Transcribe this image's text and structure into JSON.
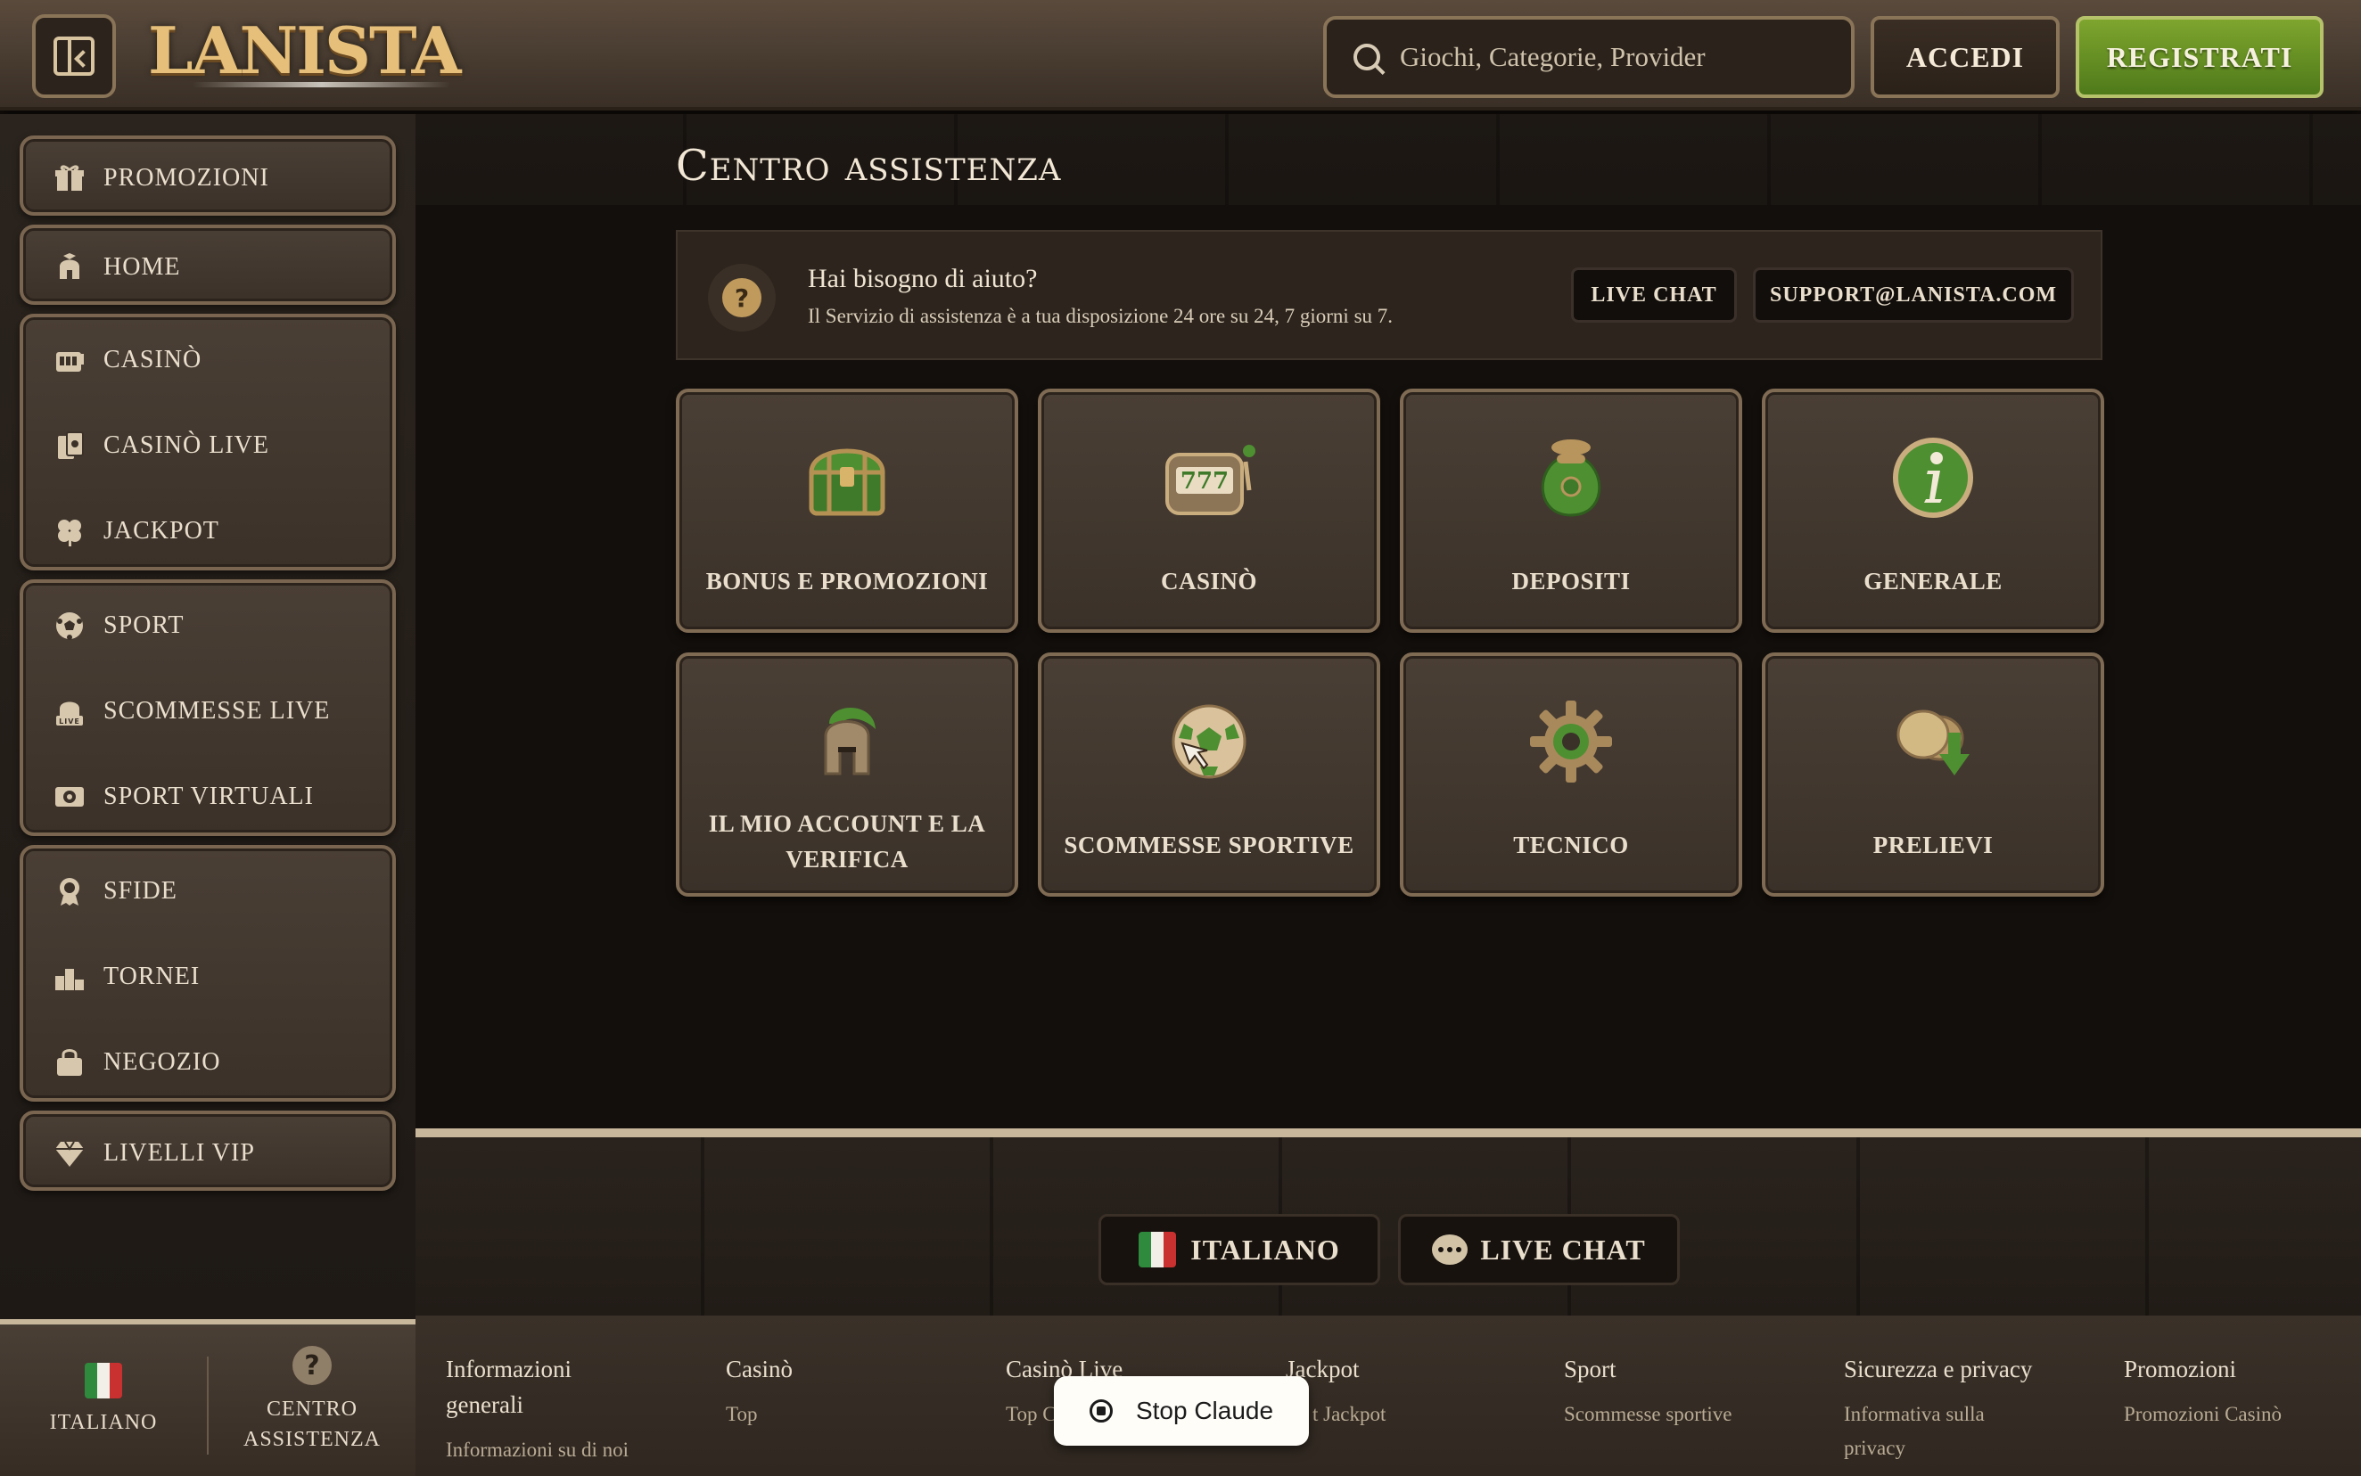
{
  "header": {
    "logo": "LANISTA",
    "search_placeholder": "Giochi, Categorie, Provider",
    "login_label": "ACCEDI",
    "register_label": "REGISTRATI"
  },
  "sidebar": {
    "items": [
      {
        "label": "PROMOZIONI",
        "icon": "gift-icon"
      },
      {
        "label": "HOME",
        "icon": "helmet-icon"
      },
      {
        "label": "CASINÒ",
        "icon": "slot-icon"
      },
      {
        "label": "CASINÒ LIVE",
        "icon": "cards-icon"
      },
      {
        "label": "JACKPOT",
        "icon": "clover-icon"
      },
      {
        "label": "SPORT",
        "icon": "soccer-ball-icon"
      },
      {
        "label": "SCOMMESSE LIVE",
        "icon": "live-helmet-icon"
      },
      {
        "label": "SPORT VIRTUALI",
        "icon": "virtual-sport-icon"
      },
      {
        "label": "SFIDE",
        "icon": "medal-icon"
      },
      {
        "label": "TORNEI",
        "icon": "podium-icon"
      },
      {
        "label": "NEGOZIO",
        "icon": "bag-icon"
      },
      {
        "label": "LIVELLI VIP",
        "icon": "diamond-icon"
      }
    ],
    "bottom": {
      "language_label": "ITALIANO",
      "help_label": "CENTRO ASSISTENZA"
    }
  },
  "main": {
    "title": "Centro assistenza",
    "banner": {
      "heading": "Hai bisogno di aiuto?",
      "subtext": "Il Servizio di assistenza è a tua disposizione 24 ore su 24, 7 giorni su 7.",
      "live_chat_label": "LIVE CHAT",
      "email_label": "SUPPORT@LANISTA.COM"
    },
    "categories": [
      {
        "label": "BONUS E PROMOZIONI",
        "icon": "treasure-chest-icon"
      },
      {
        "label": "CASINÒ",
        "icon": "slot-machine-icon"
      },
      {
        "label": "DEPOSITI",
        "icon": "money-bag-icon"
      },
      {
        "label": "GENERALE",
        "icon": "info-icon"
      },
      {
        "label": "IL MIO ACCOUNT E LA VERIFICA",
        "icon": "gladiator-helmet-icon"
      },
      {
        "label": "SCOMMESSE SPORTIVE",
        "icon": "soccer-ball-icon"
      },
      {
        "label": "TECNICO",
        "icon": "gear-icon"
      },
      {
        "label": "PRELIEVI",
        "icon": "coin-withdraw-icon"
      }
    ]
  },
  "footer": {
    "language_button": "ITALIANO",
    "live_chat_button": "LIVE CHAT",
    "columns": [
      {
        "heading": "Informazioni generali",
        "first_link": "Informazioni su di noi"
      },
      {
        "heading": "Casinò",
        "first_link": "Top"
      },
      {
        "heading": "Casinò Live",
        "first_link": "Top C"
      },
      {
        "heading": "Jackpot",
        "first_link": "t Jackpot"
      },
      {
        "heading": "Sport",
        "first_link": "Scommesse sportive"
      },
      {
        "heading": "Sicurezza e privacy",
        "first_link": "Informativa sulla privacy"
      },
      {
        "heading": "Promozioni",
        "first_link": "Promozioni Casinò"
      }
    ]
  },
  "overlay": {
    "stop_label": "Stop Claude"
  },
  "colors": {
    "accent_green": "#6a9428",
    "frame_bronze": "#7f6a53",
    "text_cream": "#eadfcd"
  }
}
